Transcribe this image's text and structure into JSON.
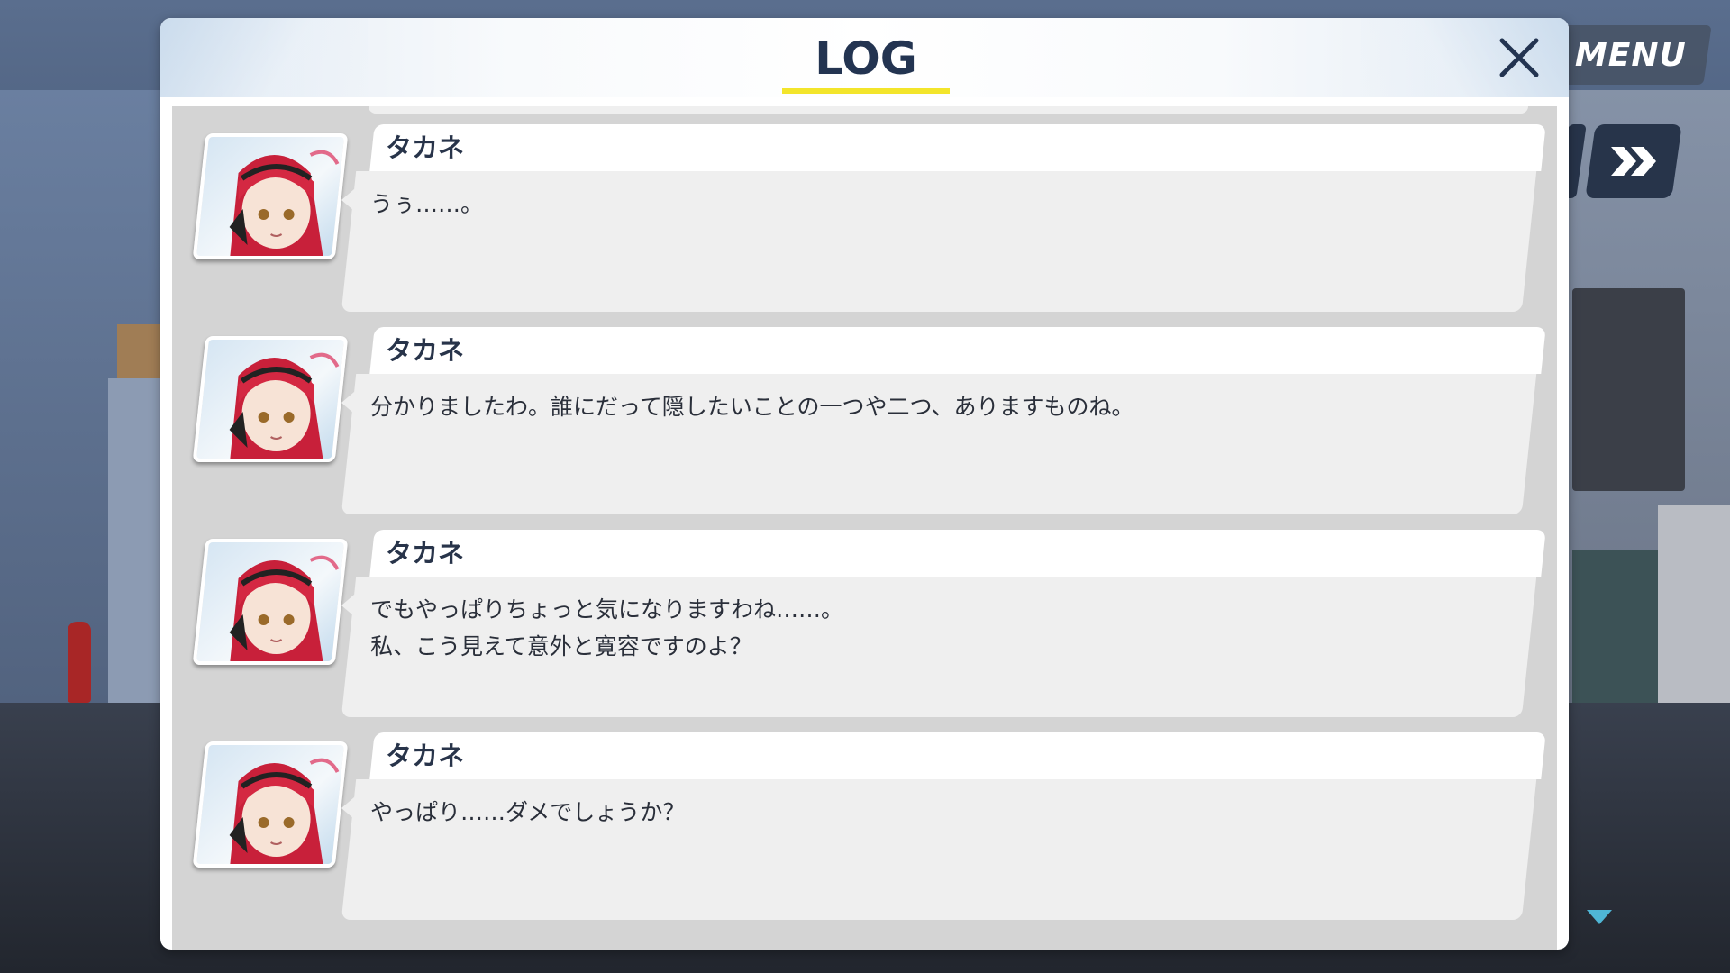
{
  "menu": {
    "label": "MENU"
  },
  "log_window": {
    "title": "LOG",
    "entries": [
      {
        "speaker": "タカネ",
        "text": "うぅ……。"
      },
      {
        "speaker": "タカネ",
        "text": "分かりましたわ。誰にだって隠したいことの一つや二つ、ありますものね。"
      },
      {
        "speaker": "タカネ",
        "text": "でもやっぱりちょっと気になりますわね……。\n私、こう見えて意外と寛容ですのよ？"
      },
      {
        "speaker": "タカネ",
        "text": "やっぱり……ダメでしょうか？"
      }
    ]
  },
  "icons": {
    "close": "close-icon",
    "fast_forward": "fast-forward-icon",
    "scroll_down": "chevron-down-icon",
    "avatar": "character-portrait"
  },
  "colors": {
    "title": "#233451",
    "title_underline": "#f3e52b",
    "scroll_area": "#d4d4d4",
    "message_bg": "#efefef",
    "name_bg": "#ffffff"
  }
}
